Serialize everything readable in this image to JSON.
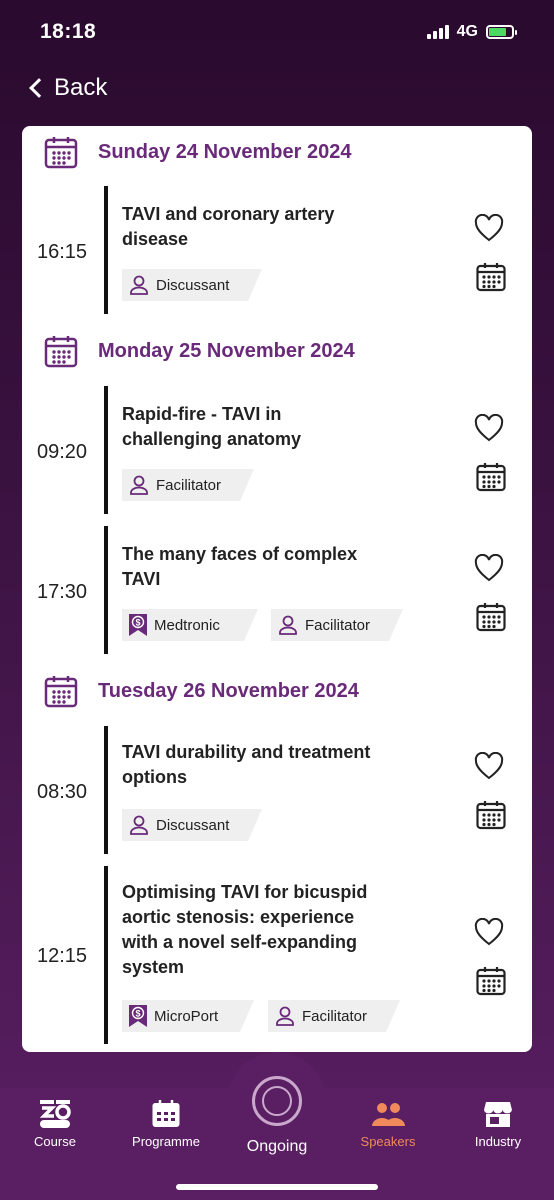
{
  "status": {
    "time": "18:18",
    "network": "4G"
  },
  "nav": {
    "back_label": "Back"
  },
  "days": [
    {
      "date": "Sunday 24 November 2024",
      "sessions": [
        {
          "time": "16:15",
          "title_lines": [
            "TAVI and coronary artery",
            "disease"
          ],
          "tags": [
            {
              "icon": "person-icon",
              "label": "Discussant"
            }
          ]
        }
      ]
    },
    {
      "date": "Monday 25 November 2024",
      "sessions": [
        {
          "time": "09:20",
          "title_lines": [
            "Rapid-fire - TAVI in",
            "challenging anatomy"
          ],
          "tags": [
            {
              "icon": "person-icon",
              "label": "Facilitator"
            }
          ]
        },
        {
          "time": "17:30",
          "title_lines": [
            "The many faces of complex",
            "TAVI"
          ],
          "tags": [
            {
              "icon": "sponsor-icon",
              "label": "Medtronic"
            },
            {
              "icon": "person-icon",
              "label": "Facilitator"
            }
          ]
        }
      ]
    },
    {
      "date": "Tuesday 26 November 2024",
      "sessions": [
        {
          "time": "08:30",
          "title_lines": [
            "TAVI durability and treatment",
            "options"
          ],
          "tags": [
            {
              "icon": "person-icon",
              "label": "Discussant"
            }
          ]
        },
        {
          "time": "12:15",
          "title_lines": [
            "Optimising TAVI for bicuspid",
            "aortic stenosis: experience",
            "with a novel self-expanding",
            "system"
          ],
          "tags": [
            {
              "icon": "sponsor-icon",
              "label": "MicroPort"
            },
            {
              "icon": "person-icon",
              "label": "Facilitator"
            }
          ]
        }
      ]
    }
  ],
  "tabs": [
    {
      "label": "Course",
      "icon": "course-logo-icon"
    },
    {
      "label": "Programme",
      "icon": "calendar-icon"
    },
    {
      "label": "Ongoing",
      "icon": "ongoing-icon"
    },
    {
      "label": "Speakers",
      "icon": "people-icon",
      "active": true
    },
    {
      "label": "Industry",
      "icon": "store-icon"
    }
  ],
  "colors": {
    "accent": "#6a2a7a",
    "active_tab": "#f08a5a",
    "tab_bg": "#5a1f63"
  }
}
